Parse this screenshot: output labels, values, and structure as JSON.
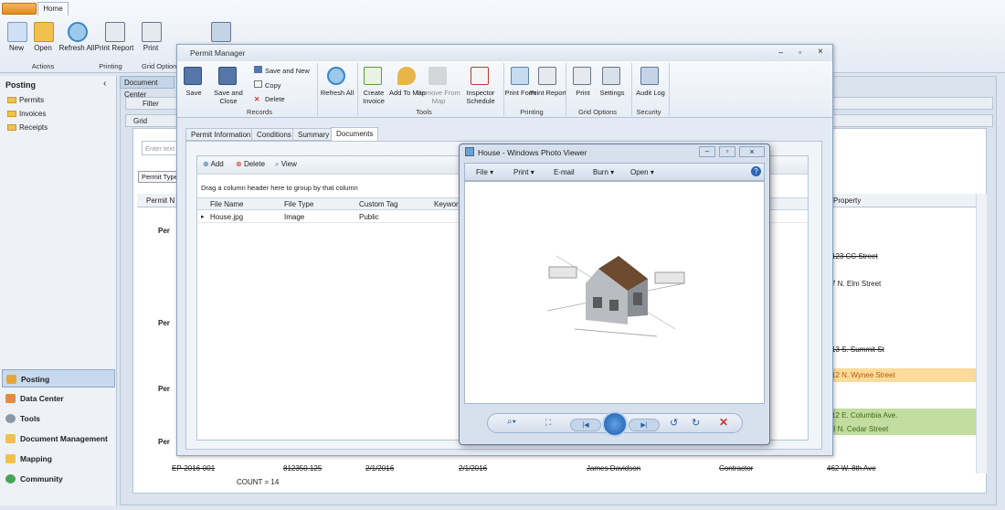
{
  "ribbon": {
    "tab": "Home",
    "buttons": {
      "new": "New",
      "open": "Open",
      "refresh": "Refresh All",
      "print_report": "Print Report",
      "print": "Print",
      "logout": "Log out"
    },
    "groups": {
      "actions": "Actions",
      "printing": "Printing",
      "grid_options": "Grid Options"
    }
  },
  "nav": {
    "posting_title": "Posting",
    "items": [
      "Permits",
      "Invoices",
      "Receipts"
    ],
    "sections": [
      "Posting",
      "Data Center",
      "Tools",
      "Document Management",
      "Mapping",
      "Community"
    ]
  },
  "bg": {
    "tab": "Document Center",
    "filter": "Filter",
    "grid": "Grid",
    "search_placeholder": "Enter text to search...",
    "permit_type": "Permit Type",
    "col_permit": "Permit N",
    "col_property": "Property",
    "group_label": "Per",
    "count": "COUNT = 14",
    "property_cells": [
      "123 CC Street",
      "7 N. Elm Street",
      "13 S. Summit St",
      "12 N. Wynee Street",
      "12 E. Columbia Ave.",
      "3 N. Cedar Street"
    ],
    "last_row": [
      "EP-2016-001",
      "812350.125",
      "2/1/2016",
      "2/1/2016",
      "James Davidson",
      "Contractor",
      "462 W. 8th Ave"
    ]
  },
  "pm": {
    "title": "Permit Manager",
    "buttons": {
      "save": "Save",
      "save_close": "Save and Close",
      "save_new": "Save and New",
      "copy": "Copy",
      "delete": "Delete",
      "refresh": "Refresh All",
      "create_invoice": "Create Invoice",
      "add_map": "Add To Map",
      "remove_map": "Remove From Map",
      "inspector": "Inspector Schedule",
      "print_form": "Print Form",
      "print_report": "Print Report",
      "print": "Print",
      "settings": "Settings",
      "audit": "Audit Log"
    },
    "groups": {
      "records": "Records",
      "tools": "Tools",
      "printing": "Printing",
      "grid_options": "Grid Options",
      "security": "Security"
    },
    "tabs": [
      "Permit Information",
      "Conditions",
      "Summary",
      "Documents"
    ],
    "doc": {
      "add": "Add",
      "delete": "Delete",
      "view": "View",
      "group_hint": "Drag a column header here to group by that column",
      "cols": [
        "File Name",
        "File Type",
        "Custom Tag",
        "Keyword"
      ],
      "row": [
        "House.jpg",
        "Image",
        "Public"
      ]
    }
  },
  "viewer": {
    "title": "House - Windows Photo Viewer",
    "menu": [
      "File",
      "Print",
      "E-mail",
      "Burn",
      "Open"
    ]
  }
}
